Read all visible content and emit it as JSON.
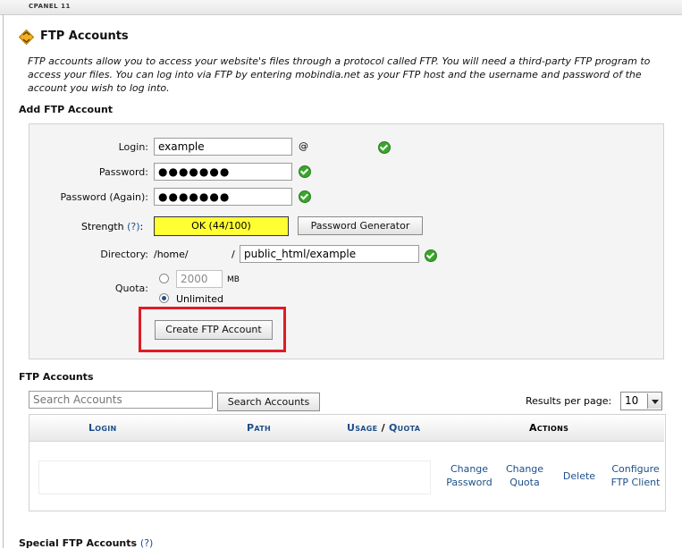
{
  "header": {
    "brand": "CPANEL 11"
  },
  "page": {
    "title": "FTP Accounts",
    "intro": "FTP accounts allow you to access your website's files through a protocol called FTP. You will need a third-party FTP program to access your files. You can log into via FTP by entering mobindia.net as your FTP host and the username and password of the account you wish to log into."
  },
  "add_form": {
    "section_title": "Add FTP Account",
    "login_label": "Login:",
    "login_value": "example",
    "at_sign": "@",
    "password_label": "Password:",
    "password_value": "●●●●●●●",
    "password_again_label": "Password (Again):",
    "password_again_value": "●●●●●●●",
    "strength_label": "Strength",
    "strength_help": "(?)",
    "strength_colon": ":",
    "strength_value": "OK (44/100)",
    "password_generator_label": "Password Generator",
    "directory_label": "Directory:",
    "directory_prefix": "/home/",
    "directory_slash": "/",
    "directory_value": "public_html/example",
    "quota_label": "Quota:",
    "quota_value": "2000",
    "quota_unit": "MB",
    "unlimited_label": "Unlimited",
    "create_button": "Create FTP Account"
  },
  "accounts": {
    "section_title": "FTP Accounts",
    "search_placeholder": "Search Accounts",
    "search_button": "Search Accounts",
    "results_label": "Results per page:",
    "results_value": "10",
    "columns": {
      "login": "Login",
      "path": "Path",
      "usage": "Usage",
      "sep": "/",
      "quota": "Quota",
      "actions": "Actions"
    },
    "row_actions": {
      "change_password_1": "Change",
      "change_password_2": "Password",
      "change_quota_1": "Change",
      "change_quota_2": "Quota",
      "delete": "Delete",
      "configure_1": "Configure",
      "configure_2": "FTP Client"
    }
  },
  "special": {
    "section_title": "Special FTP Accounts",
    "help": "(?)"
  },
  "colors": {
    "accent_link": "#1d4f8a",
    "strength_bg": "#ffff33",
    "highlight_frame": "#e01b24",
    "check_green": "#3aa52c"
  }
}
